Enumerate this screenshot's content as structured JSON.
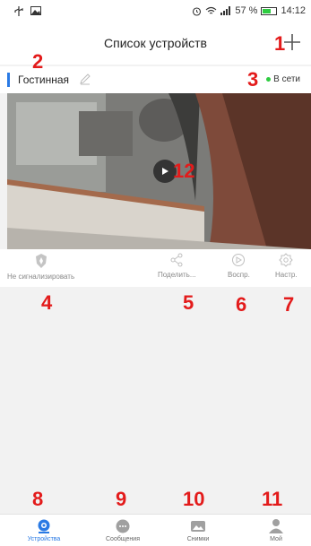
{
  "status_bar": {
    "signal_icons": "â‰ ââ",
    "battery_percent": "57 %",
    "battery_level": 0.57,
    "time": "14:12"
  },
  "header": {
    "title": "Список устройств",
    "add_icon": "plus-icon"
  },
  "device": {
    "room_name": "Гостинная",
    "status": "В сети",
    "status_color": "#2ecc40"
  },
  "actions": {
    "alarm": "Не сигнализировать",
    "share": "Поделить...",
    "playback": "Воспр.",
    "settings": "Настр."
  },
  "tabs": [
    {
      "label": "Устройства",
      "icon": "camera-icon",
      "active": true
    },
    {
      "label": "Сообщения",
      "icon": "message-icon",
      "active": false
    },
    {
      "label": "Снимки",
      "icon": "photo-icon",
      "active": false
    },
    {
      "label": "Мой",
      "icon": "user-icon",
      "active": false
    }
  ],
  "annotations": {
    "n1": "1",
    "n2": "2",
    "n3": "3",
    "n4": "4",
    "n5": "5",
    "n6": "6",
    "n7": "7",
    "n8": "8",
    "n9": "9",
    "n10": "10",
    "n11": "11",
    "n12": "12"
  },
  "colors": {
    "accent": "#2a7ae4",
    "annotation": "#e31b1b"
  }
}
